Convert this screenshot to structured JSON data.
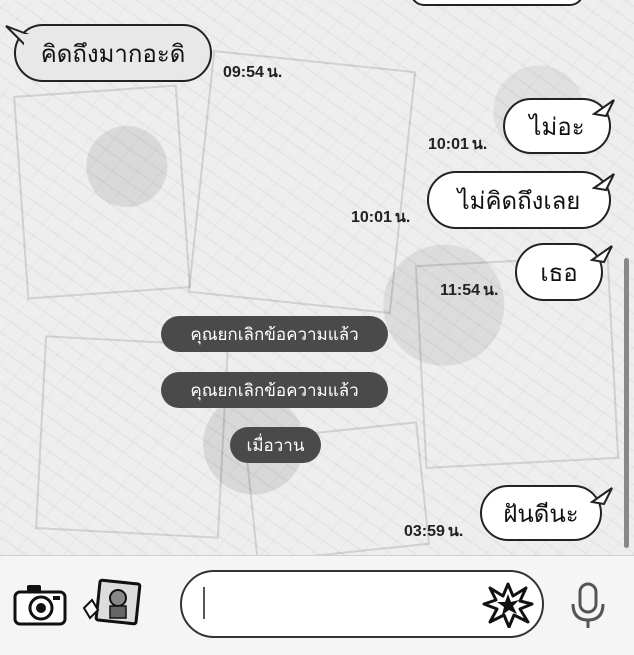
{
  "messages": [
    {
      "side": "incoming",
      "text": "คิดถึงมากอะดิ",
      "time": "09:54",
      "unit": "น."
    },
    {
      "side": "outgoing",
      "text": "ไม่อะ",
      "time": "10:01",
      "unit": "น."
    },
    {
      "side": "outgoing",
      "text": "ไม่คิดถึงเลย",
      "time": "10:01",
      "unit": "น."
    },
    {
      "side": "outgoing",
      "text": "เธอ",
      "time": "11:54",
      "unit": "น."
    },
    {
      "side": "system",
      "text": "คุณยกเลิกข้อความแล้ว"
    },
    {
      "side": "system",
      "text": "คุณยกเลิกข้อความแล้ว"
    },
    {
      "side": "system",
      "text": "เมื่อวาน"
    },
    {
      "side": "outgoing",
      "text": "ฝันดีนะ",
      "time": "03:59",
      "unit": "น."
    }
  ],
  "input": {
    "value": "",
    "placeholder": ""
  },
  "icons": {
    "camera": "camera-icon",
    "gallery": "gallery-icon",
    "sticker": "sticker-burst-icon",
    "mic": "microphone-icon"
  }
}
